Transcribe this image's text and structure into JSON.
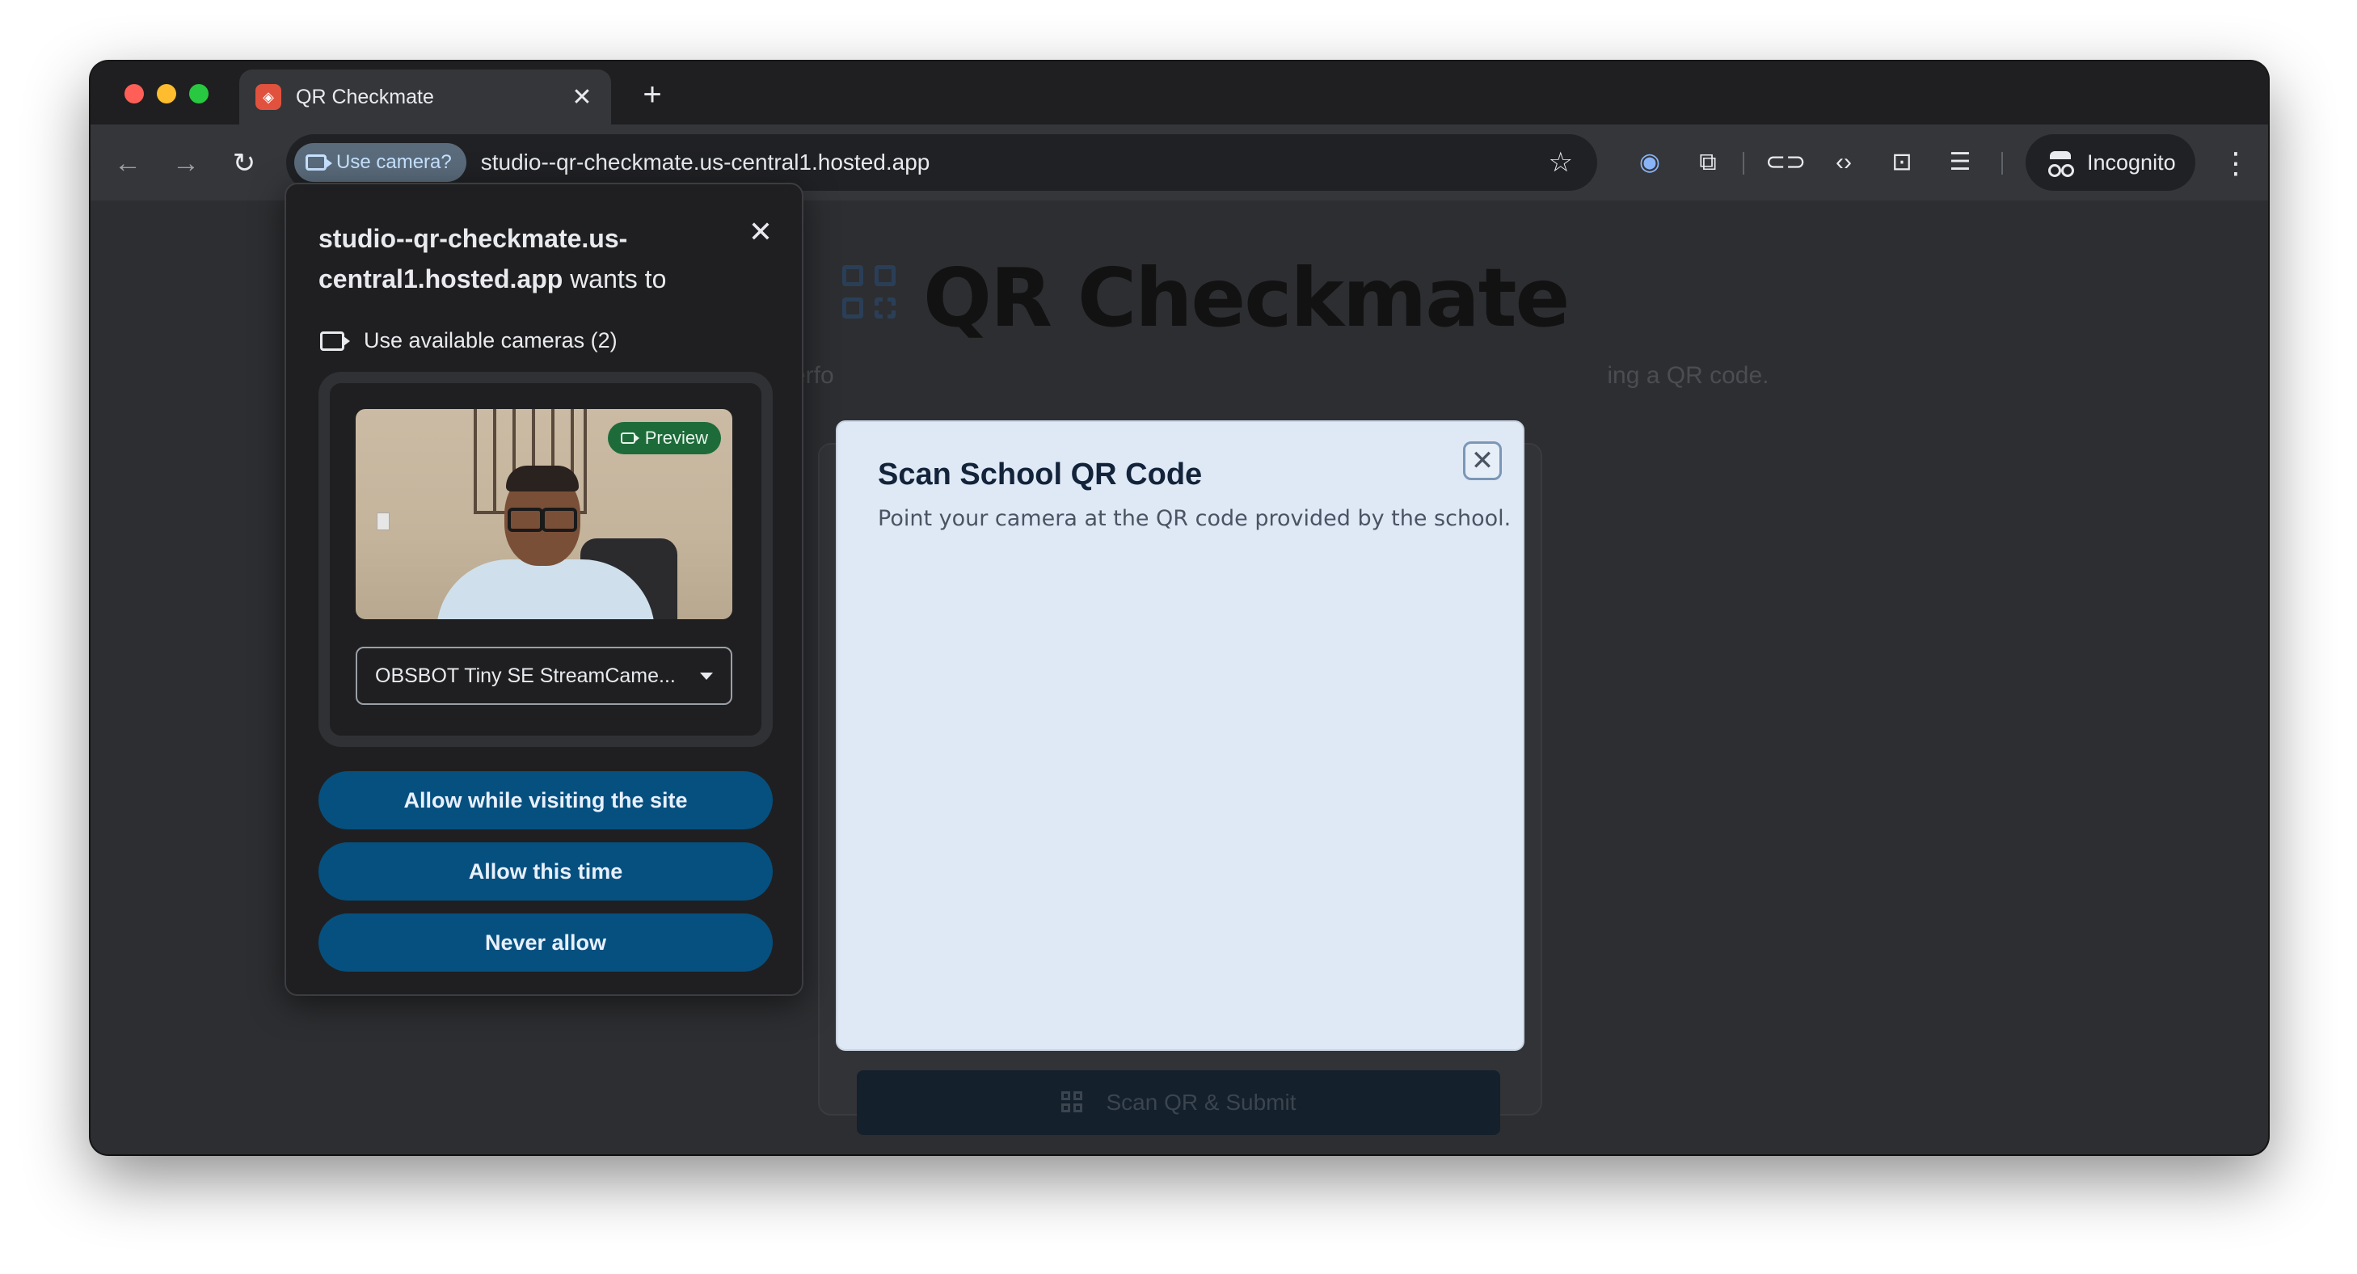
{
  "browser": {
    "tab_title": "QR Checkmate",
    "tab_close": "✕",
    "new_tab": "+",
    "permission_chip": "Use camera?",
    "url": "studio--qr-checkmate.us-central1.hosted.app",
    "profile_label": "Incognito",
    "icons": [
      "back-icon",
      "forward-icon",
      "reload-icon",
      "star-icon",
      "password-manager-icon",
      "extensions-icon",
      "link-icon",
      "devtools-icon",
      "lens-icon",
      "reading-mode-icon",
      "menu-icon"
    ]
  },
  "page": {
    "title": "QR Checkmate",
    "subtitle_left": "erfo",
    "subtitle_right": "ing a QR code.",
    "submit_label": "Scan QR & Submit"
  },
  "modal": {
    "title": "Scan School QR Code",
    "description": "Point your camera at the QR code provided by the school.",
    "close": "✕"
  },
  "permission": {
    "host_bold": "studio--qr-checkmate.us-central1.hosted.app",
    "host_suffix": " wants to",
    "option": "Use available cameras (2)",
    "preview_badge": "Preview",
    "camera_selected": "OBSBOT Tiny SE StreamCame...",
    "allow_site": "Allow while visiting the site",
    "allow_once": "Allow this time",
    "never_allow": "Never allow",
    "close": "✕"
  },
  "colors": {
    "permission_button": "#06507f",
    "modal_bg": "#dfe9f6",
    "preview_badge": "#1e6b3a"
  }
}
